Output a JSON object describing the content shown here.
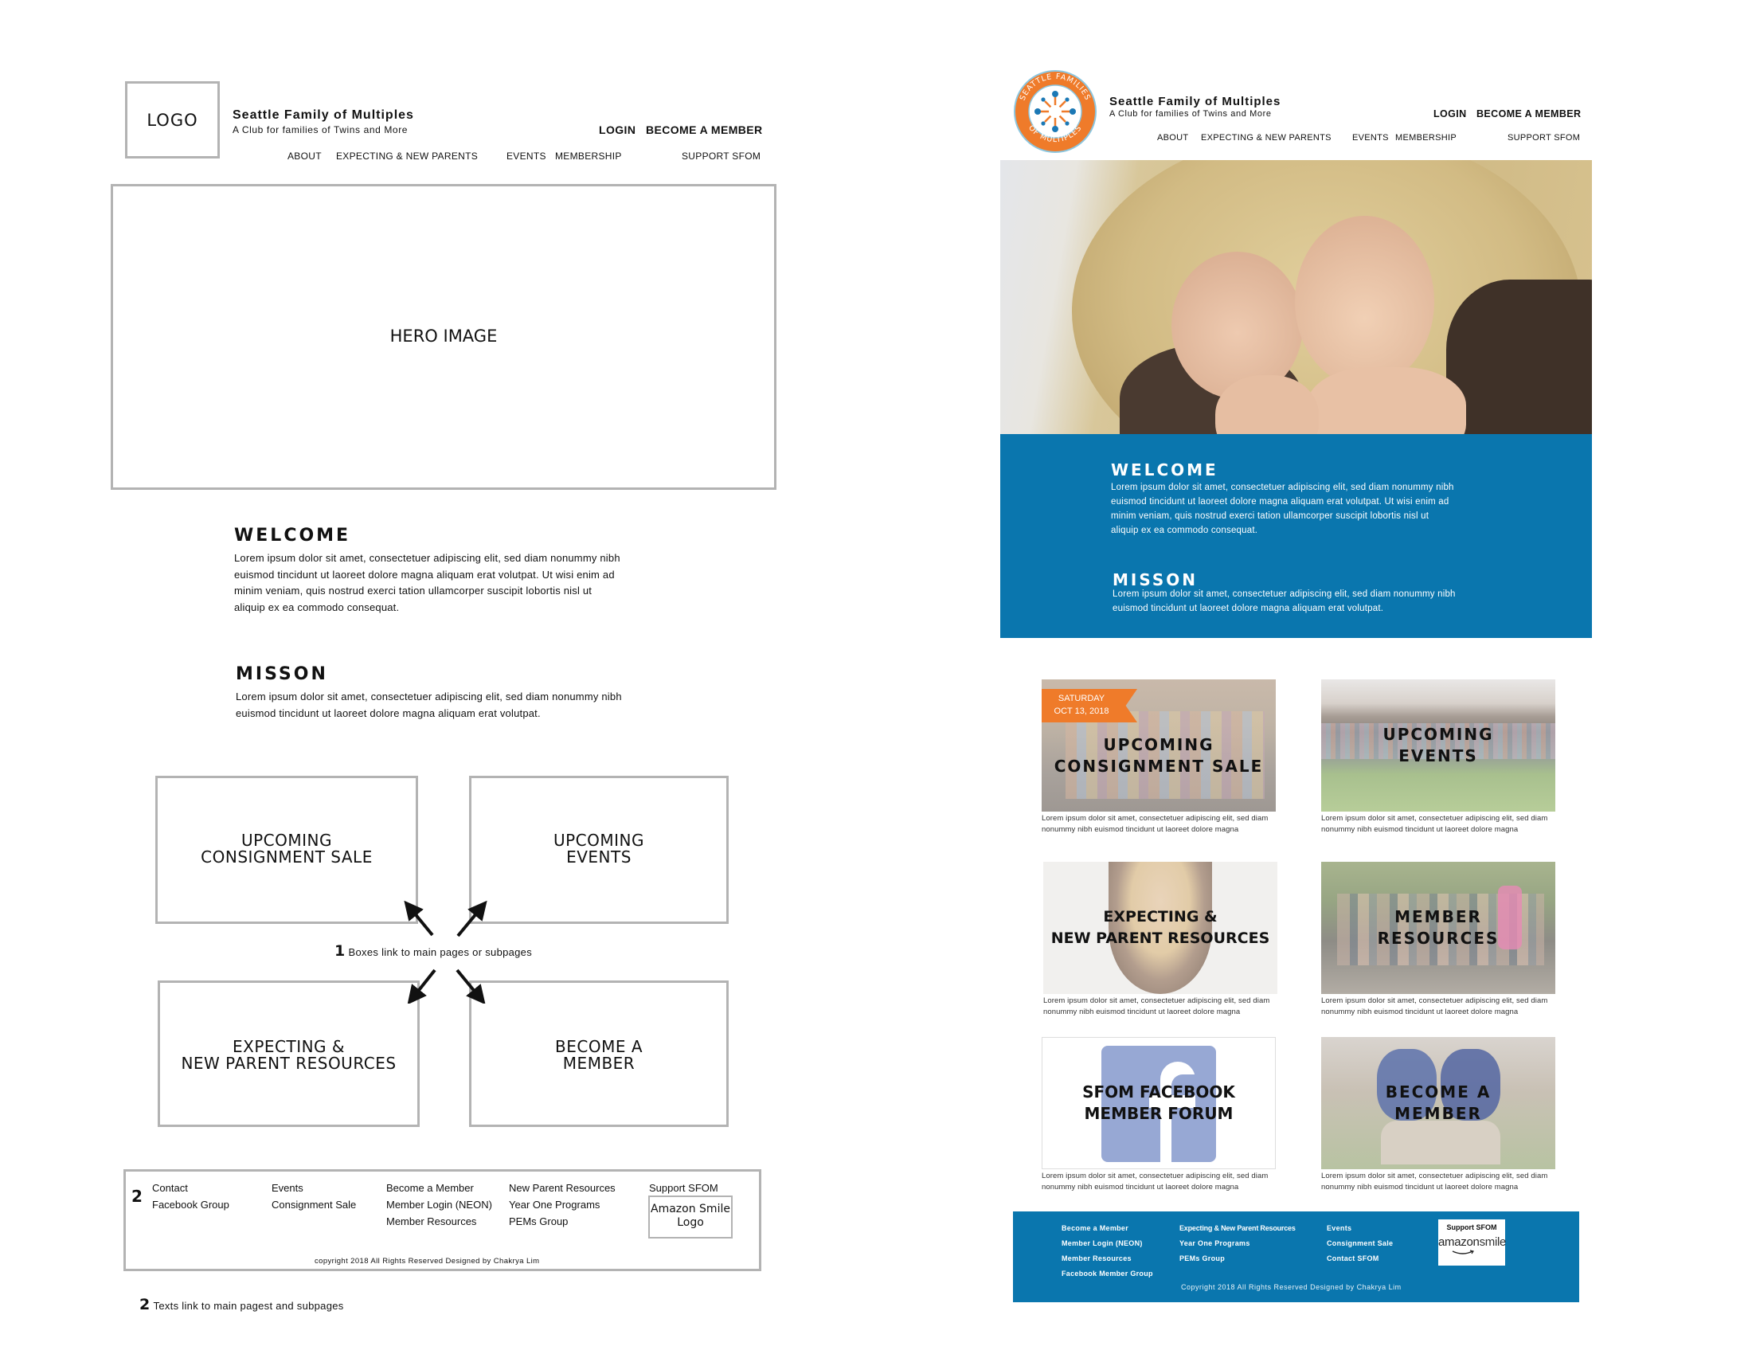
{
  "wireframe": {
    "logo_label": "LOGO",
    "brand": {
      "title": "Seattle Family of Multiples",
      "subtitle": "A Club for families of Twins and More"
    },
    "top_links": [
      "LOGIN",
      "BECOME A MEMBER"
    ],
    "nav": [
      "ABOUT",
      "EXPECTING & NEW PARENTS",
      "EVENTS",
      "MEMBERSHIP",
      "SUPPORT SFOM"
    ],
    "hero_label": "HERO IMAGE",
    "welcome": {
      "heading": "WELCOME",
      "lines": [
        "Lorem ipsum dolor sit amet, consectetuer adipiscing elit, sed diam nonummy nibh",
        "euismod tincidunt ut laoreet dolore magna aliquam erat volutpat. Ut wisi enim ad",
        "minim veniam, quis nostrud exerci tation ullamcorper suscipit lobortis nisl ut",
        "aliquip ex ea commodo consequat."
      ]
    },
    "mission": {
      "heading": "MISSON",
      "lines": [
        "Lorem ipsum dolor sit amet, consectetuer adipiscing elit, sed diam nonummy nibh",
        "euismod tincidunt ut laoreet dolore magna aliquam erat volutpat."
      ]
    },
    "boxes": [
      "UPCOMING\nCONSIGNMENT SALE",
      "UPCOMING\nEVENTS",
      "EXPECTING &\nNEW PARENT RESOURCES",
      "BECOME A\nMEMBER"
    ],
    "note1": {
      "number": "1",
      "text": "Boxes link to main pages or subpages"
    },
    "footer": {
      "number": "2",
      "col1": [
        "Contact",
        "Facebook Group"
      ],
      "col2": [
        "Events",
        "Consignment Sale"
      ],
      "col3": [
        "Become a Member",
        "Member Login (NEON)",
        "Member Resources"
      ],
      "col4": [
        "New Parent Resources",
        "Year One Programs",
        "PEMs Group"
      ],
      "col5_title": "Support SFOM",
      "amazon_box": "Amazon Smile\nLogo",
      "copyright": "copyright 2018 All Rights Reserved Designed by Chakrya Lim"
    },
    "note2": {
      "number": "2",
      "text": "Texts link to main pagest and subpages"
    }
  },
  "mockup": {
    "logo": {
      "top_text": "SEATTLE FAMILIES",
      "bottom_text": "OF MULTIPLES"
    },
    "brand": {
      "title": "Seattle Family of Multiples",
      "subtitle": "A Club for families of Twins and More"
    },
    "top_links": [
      "LOGIN",
      "BECOME A MEMBER"
    ],
    "nav": [
      "ABOUT",
      "EXPECTING & NEW PARENTS",
      "EVENTS",
      "MEMBERSHIP",
      "SUPPORT SFOM"
    ],
    "welcome": {
      "heading": "WELCOME",
      "lines": [
        "Lorem ipsum dolor sit amet, consectetuer adipiscing elit, sed diam nonummy nibh",
        "euismod tincidunt ut laoreet dolore magna aliquam erat volutpat. Ut wisi enim ad",
        "minim veniam, quis nostrud exerci tation ullamcorper suscipit lobortis nisl ut",
        "aliquip ex ea commodo consequat."
      ]
    },
    "mission": {
      "heading": "MISSON",
      "lines": [
        "Lorem ipsum dolor sit amet, consectetuer adipiscing elit, sed diam nonummy nibh",
        "euismod tincidunt ut laoreet dolore magna aliquam erat volutpat."
      ]
    },
    "date_banner": [
      "SATURDAY",
      "OCT 13, 2018"
    ],
    "cards": [
      {
        "title": "UPCOMING\nCONSIGNMENT SALE",
        "caption": [
          "Lorem ipsum dolor sit amet, consectetuer adipiscing elit, sed diam",
          "nonummy nibh euismod tincidunt ut laoreet dolore magna"
        ]
      },
      {
        "title": "UPCOMING\nEVENTS",
        "caption": [
          "Lorem ipsum dolor sit amet, consectetuer adipiscing elit, sed diam",
          "nonummy nibh euismod tincidunt ut laoreet dolore magna"
        ]
      },
      {
        "title": "EXPECTING &\nNEW PARENT RESOURCES",
        "caption": [
          "Lorem ipsum dolor sit amet, consectetuer adipiscing elit, sed diam",
          "nonummy nibh euismod tincidunt ut laoreet dolore magna"
        ]
      },
      {
        "title": "MEMBER\nRESOURCES",
        "caption": [
          "Lorem ipsum dolor sit amet, consectetuer adipiscing elit, sed diam",
          "nonummy nibh euismod tincidunt ut laoreet dolore magna"
        ]
      },
      {
        "title": "SFOM FACEBOOK\nMEMBER FORUM",
        "caption": [
          "Lorem ipsum dolor sit amet, consectetuer adipiscing elit, sed diam",
          "nonummy nibh euismod tincidunt ut laoreet dolore magna"
        ]
      },
      {
        "title": "BECOME A\nMEMBER",
        "caption": [
          "Lorem ipsum dolor sit amet, consectetuer adipiscing elit, sed diam",
          "nonummy nibh euismod tincidunt ut laoreet dolore magna"
        ]
      }
    ],
    "footer": {
      "col1": [
        "Become a Member",
        "Member Login (NEON)",
        "Member Resources",
        "Facebook Member Group"
      ],
      "col2": [
        "Expecting & New Parent Resources",
        "Year One Programs",
        "PEMs Group"
      ],
      "col3": [
        "Events",
        "Consignment Sale",
        "Contact SFOM"
      ],
      "support_title": "Support SFOM",
      "amazon": {
        "a": "amazon",
        "b": "smile"
      },
      "copyright": "Copyright 2018 All Rights Reserved Designed by Chakrya Lim"
    },
    "colors": {
      "blue": "#0a76ae",
      "orange": "#ef7b2a",
      "logo_blue": "#1b78b5"
    }
  }
}
